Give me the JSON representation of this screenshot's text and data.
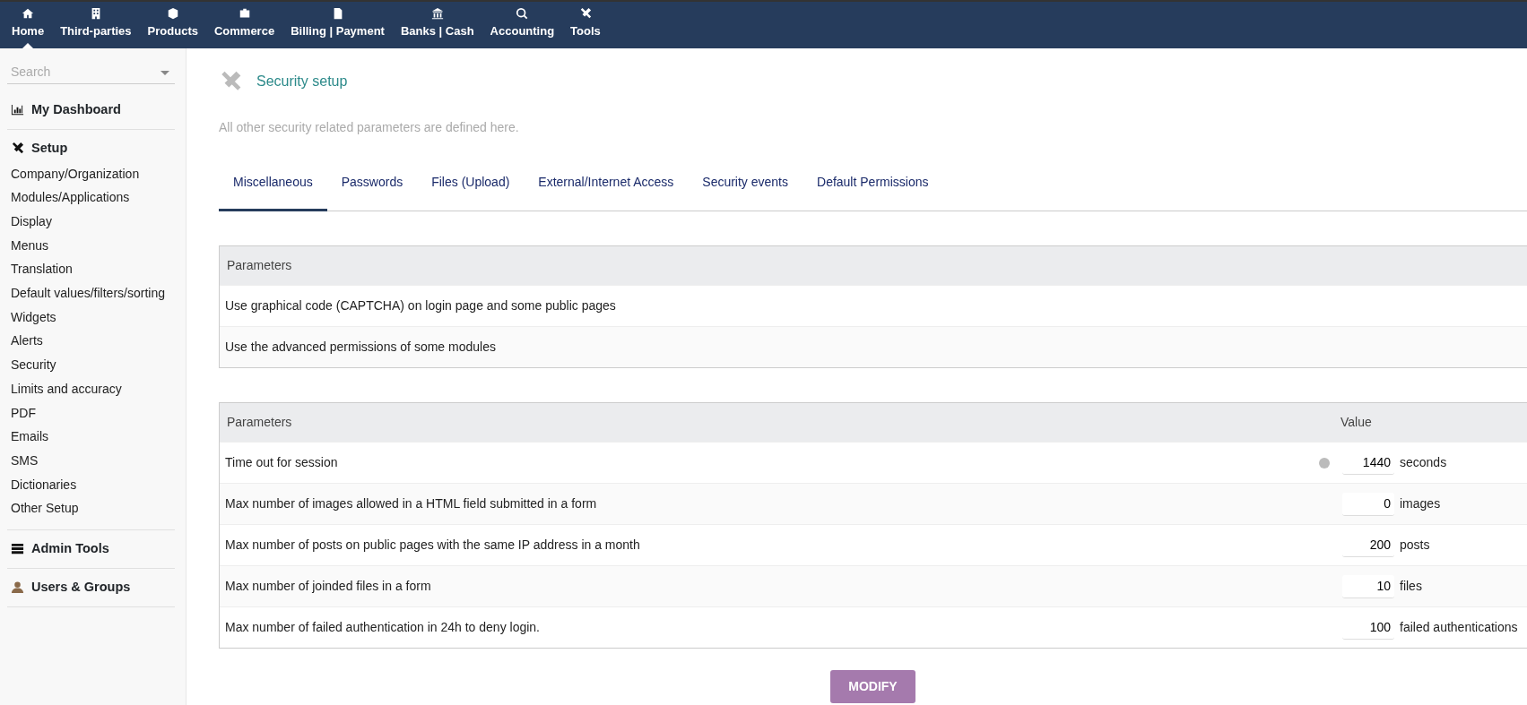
{
  "top_menu": [
    {
      "label": "Home",
      "selected": true
    },
    {
      "label": "Third-parties",
      "selected": false
    },
    {
      "label": "Products",
      "selected": false
    },
    {
      "label": "Commerce",
      "selected": false
    },
    {
      "label": "Billing | Payment",
      "selected": false
    },
    {
      "label": "Banks | Cash",
      "selected": false
    },
    {
      "label": "Accounting",
      "selected": false
    },
    {
      "label": "Tools",
      "selected": false
    }
  ],
  "sidebar": {
    "search": {
      "placeholder": "Search"
    },
    "sections": [
      {
        "title": "My Dashboard"
      },
      {
        "title": "Setup",
        "items": [
          "Company/Organization",
          "Modules/Applications",
          "Display",
          "Menus",
          "Translation",
          "Default values/filters/sorting",
          "Widgets",
          "Alerts",
          "Security",
          "Limits and accuracy",
          "PDF",
          "Emails",
          "SMS",
          "Dictionaries",
          "Other Setup"
        ]
      },
      {
        "title": "Admin Tools"
      },
      {
        "title": "Users & Groups"
      }
    ]
  },
  "page": {
    "title": "Security setup",
    "description": "All other security related parameters are defined here.",
    "tabs": [
      {
        "label": "Miscellaneous",
        "selected": true
      },
      {
        "label": "Passwords",
        "selected": false
      },
      {
        "label": "Files (Upload)",
        "selected": false
      },
      {
        "label": "External/Internet Access",
        "selected": false
      },
      {
        "label": "Security events",
        "selected": false
      },
      {
        "label": "Default Permissions",
        "selected": false
      }
    ],
    "options_table": {
      "columns": [
        "Parameters"
      ],
      "rows": [
        "Use graphical code (CAPTCHA) on login page and some public pages",
        "Use the advanced permissions of some modules"
      ]
    },
    "values_table": {
      "columns": [
        "Parameters",
        "Value"
      ],
      "rows": [
        {
          "label": "Time out for session",
          "info": true,
          "value": "1440",
          "unit": "seconds"
        },
        {
          "label": "Max number of images allowed in a HTML field submitted in a form",
          "info": false,
          "value": "0",
          "unit": "images"
        },
        {
          "label": "Max number of posts on public pages with the same IP address in a month",
          "info": false,
          "value": "200",
          "unit": "posts"
        },
        {
          "label": "Max number of joinded files in a form",
          "info": false,
          "value": "10",
          "unit": "files"
        },
        {
          "label": "Max number of failed authentication in 24h to deny login.",
          "info": false,
          "value": "100",
          "unit": "failed authentications"
        }
      ]
    },
    "button": "MODIFY"
  }
}
